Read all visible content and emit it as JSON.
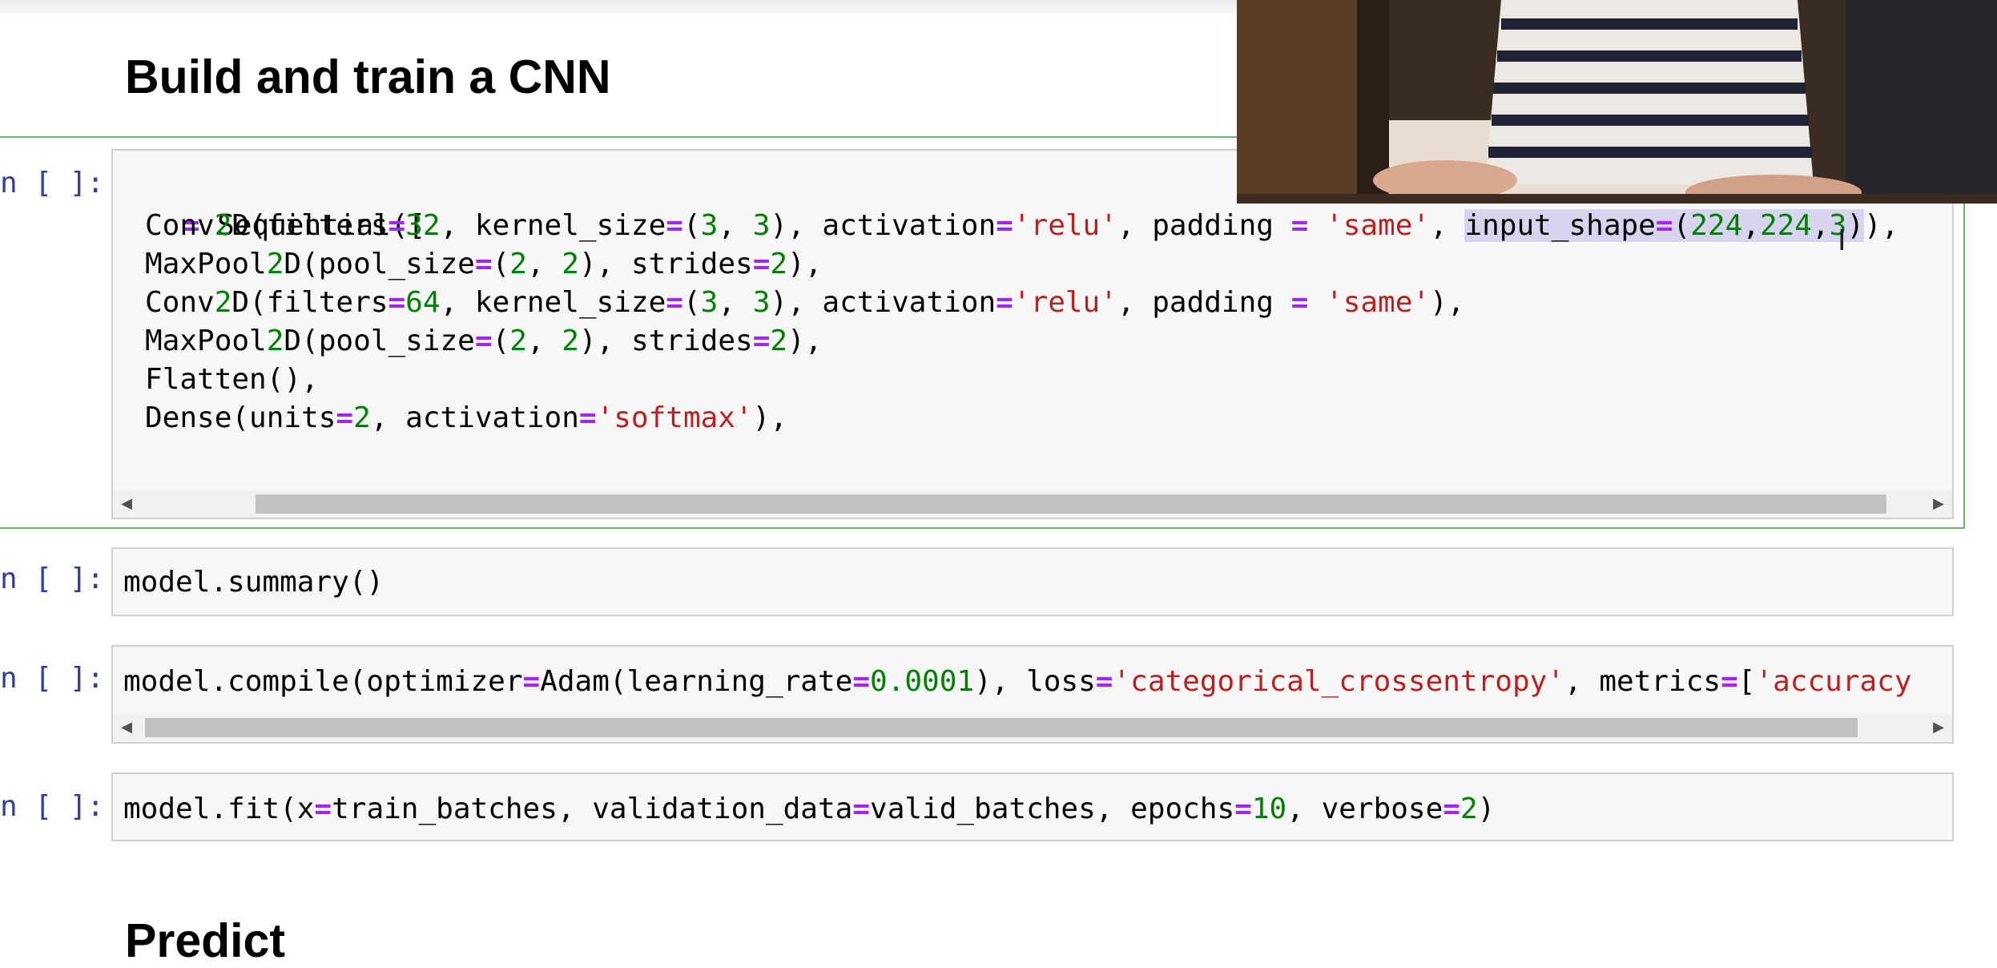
{
  "notebook": {
    "heading": "Build and train a CNN",
    "next_heading": "Predict",
    "prompt_label": "n [ ]:",
    "cells": [
      {
        "lines": [
          "= Sequential([",
          "Conv2D(filters=32, kernel_size=(3, 3), activation='relu', padding = 'same', input_shape=(224,224,3)),",
          "MaxPool2D(pool_size=(2, 2), strides=2),",
          "Conv2D(filters=64, kernel_size=(3, 3), activation='relu', padding = 'same'),",
          "MaxPool2D(pool_size=(2, 2), strides=2),",
          "Flatten(),",
          "Dense(units=2, activation='softmax'),"
        ]
      },
      {
        "lines": [
          "model.summary()"
        ]
      },
      {
        "lines": [
          "model.compile(optimizer=Adam(learning_rate=0.0001), loss='categorical_crossentropy', metrics=['accuracy"
        ]
      },
      {
        "lines": [
          "model.fit(x=train_batches, validation_data=valid_batches, epochs=10, verbose=2)"
        ]
      }
    ],
    "selected_text": "input_shape=(224,224,3)"
  },
  "colors": {
    "prompt": "#303f9f",
    "selected_border": "#66bb6a",
    "operator": "#aa22ff",
    "number": "#008000",
    "string": "#ba2121"
  },
  "icons": {
    "scroll_left": "◀",
    "scroll_right": "▶",
    "cursor": "I"
  }
}
